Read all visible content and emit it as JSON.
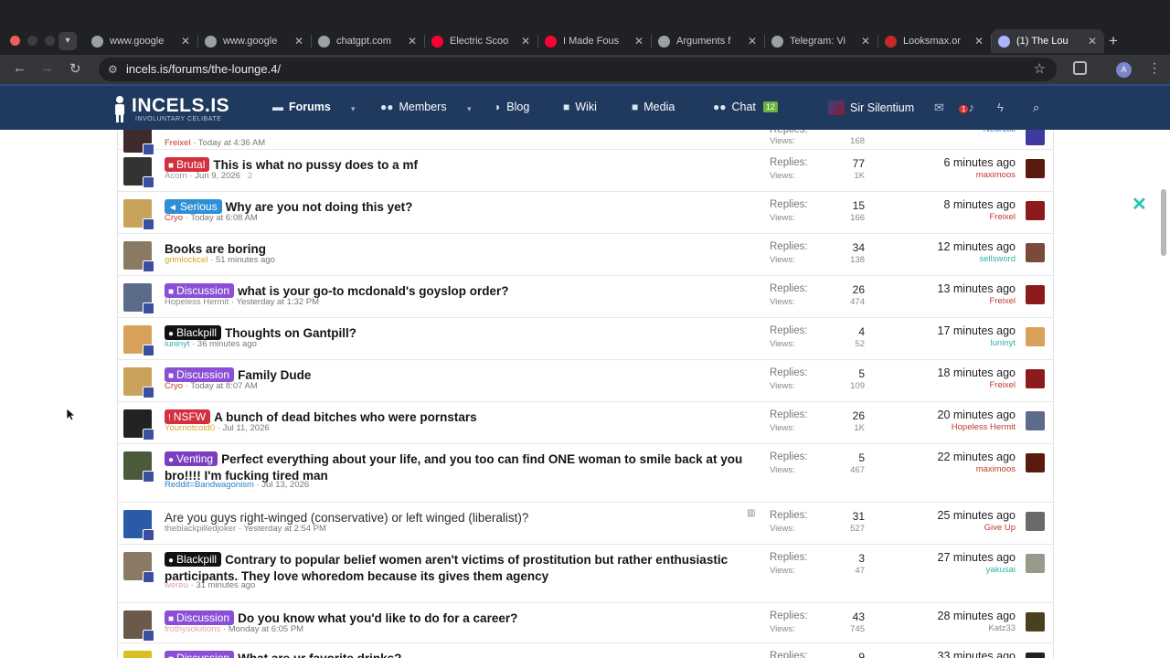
{
  "browser": {
    "window_controls": [
      "#ec5f57",
      "#3d3d3d",
      "#3d3d3d"
    ],
    "tabs": [
      {
        "title": "www.google",
        "favicon": "google-icon",
        "color": "#9aa0a6"
      },
      {
        "title": "www.google",
        "favicon": "google-icon",
        "color": "#9aa0a6"
      },
      {
        "title": "chatgpt.com",
        "favicon": "openai-icon",
        "color": "#9aa0a6"
      },
      {
        "title": "Electric Scoo",
        "favicon": "youtube-icon",
        "color": "#ff0033"
      },
      {
        "title": "I Made Fous",
        "favicon": "youtube-icon",
        "color": "#ff0033"
      },
      {
        "title": "Arguments f",
        "favicon": "openai-icon",
        "color": "#9aa0a6"
      },
      {
        "title": "Telegram: Vi",
        "favicon": "globe-icon",
        "color": "#9aa0a6"
      },
      {
        "title": "Looksmax.or",
        "favicon": "looksmax-icon",
        "color": "#c62828"
      },
      {
        "title": "(1) The Lou",
        "favicon": "incels-icon",
        "color": "#aab4ff"
      }
    ],
    "url": "incels.is/forums/the-lounge.4/",
    "profile_initial": "A"
  },
  "site": {
    "brand": "INCELS.IS",
    "tagline": "INVOLUNTARY CELIBATE",
    "nav": {
      "forums": "Forums",
      "members": "Members",
      "blog": "Blog",
      "wiki": "Wiki",
      "media": "Media",
      "chat": "Chat",
      "chat_count": "12"
    },
    "username": "Sir Silentium",
    "alerts_count": "1"
  },
  "labels": {
    "replies": "Replies:",
    "views": "Views:"
  },
  "threads": [
    {
      "title": "",
      "prefix": null,
      "author": "Freixel",
      "author_color": "#c0392b",
      "date": "Today at 4:36 AM",
      "replies": "",
      "views": "168",
      "last_time": "",
      "last_user": "Neurotic",
      "last_user_color": "#2d7fbf",
      "avatar": "#3d2a2a",
      "last_avatar": "#3d3aa0"
    },
    {
      "title": "This is what no pussy does to a mf",
      "prefix": {
        "label": "Brutal",
        "color": "#d32f3f",
        "icon": "lock-icon",
        "glyph": "■"
      },
      "author": "Acorn",
      "author_color": "#999999",
      "date": "Jun 9, 2026",
      "pages": "2",
      "replies": "77",
      "views": "1K",
      "last_time": "6 minutes ago",
      "last_user": "maximoos",
      "last_user_color": "#c0392b",
      "avatar": "#333333",
      "last_avatar": "#5a1a10"
    },
    {
      "title": "Why are you not doing this yet?",
      "prefix": {
        "label": "Serious",
        "color": "#2f8fd6",
        "icon": "megaphone-icon",
        "glyph": "◄"
      },
      "author": "Cryo",
      "author_color": "#c0392b",
      "date": "Today at 6:08 AM",
      "replies": "15",
      "views": "166",
      "last_time": "8 minutes ago",
      "last_user": "Freixel",
      "last_user_color": "#c0392b",
      "avatar": "#c9a35a",
      "last_avatar": "#8e1b1b"
    },
    {
      "title": "Books are boring",
      "prefix": null,
      "author": "grimlockcel",
      "author_color": "#d4a72c",
      "date": "51 minutes ago",
      "replies": "34",
      "views": "138",
      "last_time": "12 minutes ago",
      "last_user": "sellsword",
      "last_user_color": "#2db3a4",
      "avatar": "#8a7a64",
      "last_avatar": "#7a4a3a"
    },
    {
      "title": "what is your go-to mcdonald's goyslop order?",
      "prefix": {
        "label": "Discussion",
        "color": "#8a4fd6",
        "icon": "comments-icon",
        "glyph": "■"
      },
      "author": "Hopeless Hermit",
      "author_color": "#888888",
      "date": "Yesterday at 1:32 PM",
      "replies": "26",
      "views": "474",
      "last_time": "13 minutes ago",
      "last_user": "Freixel",
      "last_user_color": "#c0392b",
      "avatar": "#5c6b8a",
      "last_avatar": "#8e1b1b"
    },
    {
      "title": "Thoughts on Gantpill?",
      "prefix": {
        "label": "Blackpill",
        "color": "#111111",
        "icon": "gamepad-icon",
        "glyph": "●"
      },
      "author": "luninyt",
      "author_color": "#2db3a4",
      "date": "36 minutes ago",
      "replies": "4",
      "views": "52",
      "last_time": "17 minutes ago",
      "last_user": "luninyt",
      "last_user_color": "#2db3a4",
      "avatar": "#d8a25a",
      "last_avatar": "#d8a25a"
    },
    {
      "title": "Family Dude",
      "prefix": {
        "label": "Discussion",
        "color": "#8a4fd6",
        "icon": "comments-icon",
        "glyph": "■"
      },
      "author": "Cryo",
      "author_color": "#c0392b",
      "date": "Today at 8:07 AM",
      "replies": "5",
      "views": "109",
      "last_time": "18 minutes ago",
      "last_user": "Freixel",
      "last_user_color": "#c0392b",
      "avatar": "#c9a35a",
      "last_avatar": "#8e1b1b"
    },
    {
      "title": "A bunch of dead bitches who were pornstars",
      "prefix": {
        "label": "NSFW",
        "color": "#d32f3f",
        "icon": "alert-icon",
        "glyph": "!"
      },
      "author": "Yournotcold0",
      "author_color": "#d4a72c",
      "date": "Jul 11, 2026",
      "replies": "26",
      "views": "1K",
      "last_time": "20 minutes ago",
      "last_user": "Hopeless Hermit",
      "last_user_color": "#c0392b",
      "avatar": "#222222",
      "last_avatar": "#5c6b8a"
    },
    {
      "title": "Perfect everything about your life, and you too can find ONE woman to smile back at you bro!!!! I'm fucking tired man",
      "prefix": {
        "label": "Venting",
        "color": "#7a3fc0",
        "icon": "venting-icon",
        "glyph": "●"
      },
      "author": "Reddit=Bandwagonism",
      "author_color": "#2d7fbf",
      "date": "Jul 13, 2026",
      "replies": "5",
      "views": "467",
      "last_time": "22 minutes ago",
      "last_user": "maximoos",
      "last_user_color": "#c0392b",
      "avatar": "#4a5a3a",
      "last_avatar": "#5a1a10"
    },
    {
      "title": "Are you guys right-winged (conservative) or left winged (liberalist)?",
      "prefix": null,
      "normal": true,
      "author": "theblackpilledjoker",
      "author_color": "#888888",
      "date": "Yesterday at 2:54 PM",
      "replies": "31",
      "views": "527",
      "last_time": "25 minutes ago",
      "last_user": "Give Up",
      "last_user_color": "#c0392b",
      "avatar": "#2b5aa8",
      "last_avatar": "#6a6a6a"
    },
    {
      "title": "Contrary to popular belief women aren't victims of prostitution but rather enthusiastic participants. They love whoredom because its gives them agency",
      "prefix": {
        "label": "Blackpill",
        "color": "#111111",
        "icon": "gamepad-icon",
        "glyph": "●"
      },
      "author": "wereu",
      "author_color": "#e0a0b0",
      "date": "31 minutes ago",
      "replies": "3",
      "views": "47",
      "last_time": "27 minutes ago",
      "last_user": "yakusai",
      "last_user_color": "#2db3a4",
      "avatar": "#8a7a64",
      "last_avatar": "#9a9a8a"
    },
    {
      "title": "Do you know what you'd like to do for a career?",
      "prefix": {
        "label": "Discussion",
        "color": "#8a4fd6",
        "icon": "comments-icon",
        "glyph": "■"
      },
      "author": "frothysolutions",
      "author_color": "#e0a0b0",
      "date": "Monday at 6:05 PM",
      "replies": "43",
      "views": "745",
      "last_time": "28 minutes ago",
      "last_user": "Katz33",
      "last_user_color": "#888888",
      "avatar": "#6a5a4a",
      "last_avatar": "#4a4020"
    },
    {
      "title": "What are ur favorite drinks?",
      "prefix": {
        "label": "Discussion",
        "color": "#8a4fd6",
        "icon": "comments-icon",
        "glyph": "■"
      },
      "author": "",
      "author_color": "#888888",
      "date": "",
      "replies": "9",
      "views": "",
      "last_time": "33 minutes ago",
      "last_user": "",
      "last_user_color": "#888888",
      "avatar": "#d8c020",
      "last_avatar": "#222222"
    }
  ]
}
